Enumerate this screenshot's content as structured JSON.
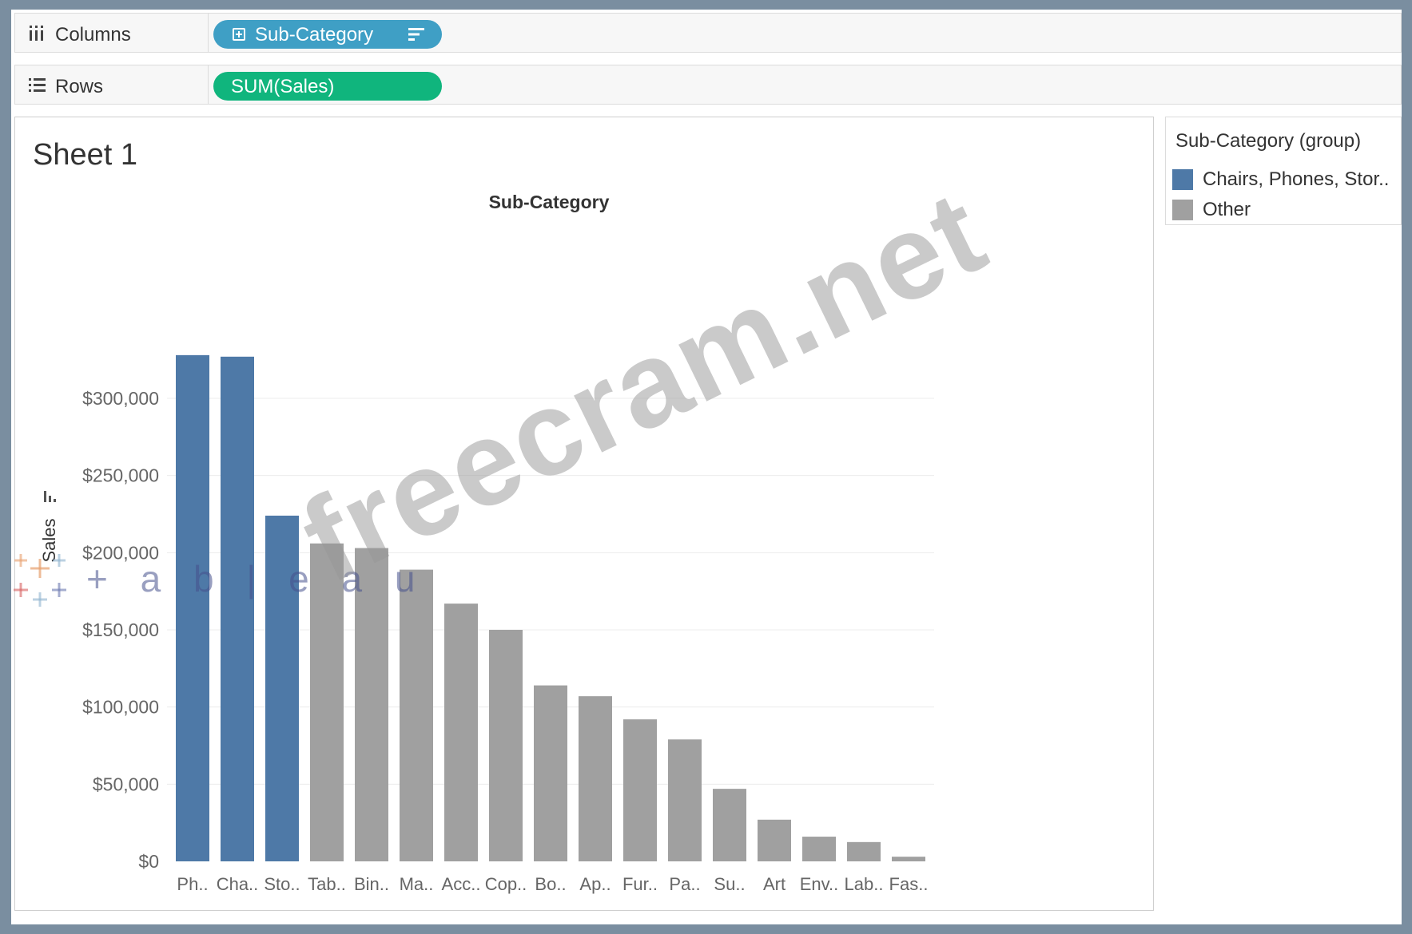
{
  "shelves": {
    "columns": {
      "label": "Columns",
      "pill": "Sub-Category"
    },
    "rows": {
      "label": "Rows",
      "pill": "SUM(Sales)"
    }
  },
  "sheet": {
    "title": "Sheet 1"
  },
  "legend": {
    "title": "Sub-Category (group)",
    "items": [
      {
        "label": "Chairs, Phones, Stor..",
        "color": "#4e79a7"
      },
      {
        "label": "Other",
        "color": "#a0a0a0"
      }
    ]
  },
  "watermark": {
    "text": "freecram.net",
    "logo_text": "+ a b | e a u"
  },
  "chart_data": {
    "type": "bar",
    "title": "Sub-Category",
    "xlabel": "",
    "ylabel": "Sales",
    "ylim": [
      0,
      330000
    ],
    "grid": true,
    "yticks": [
      {
        "value": 0,
        "label": "$0"
      },
      {
        "value": 50000,
        "label": "$50,000"
      },
      {
        "value": 100000,
        "label": "$100,000"
      },
      {
        "value": 150000,
        "label": "$150,000"
      },
      {
        "value": 200000,
        "label": "$200,000"
      },
      {
        "value": 250000,
        "label": "$250,000"
      },
      {
        "value": 300000,
        "label": "$300,000"
      }
    ],
    "categories": [
      "Ph..",
      "Cha..",
      "Sto..",
      "Tab..",
      "Bin..",
      "Ma..",
      "Acc..",
      "Cop..",
      "Bo..",
      "Ap..",
      "Fur..",
      "Pa..",
      "Su..",
      "Art",
      "Env..",
      "Lab..",
      "Fas.."
    ],
    "values": [
      328000,
      327000,
      224000,
      206000,
      203000,
      189000,
      167000,
      150000,
      114000,
      107000,
      92000,
      79000,
      47000,
      27000,
      16000,
      12500,
      3000
    ],
    "groups": [
      "Chairs, Phones, Stor..",
      "Chairs, Phones, Stor..",
      "Chairs, Phones, Stor..",
      "Other",
      "Other",
      "Other",
      "Other",
      "Other",
      "Other",
      "Other",
      "Other",
      "Other",
      "Other",
      "Other",
      "Other",
      "Other",
      "Other"
    ],
    "colors": {
      "Chairs, Phones, Stor..": "#4e79a7",
      "Other": "#a0a0a0"
    }
  }
}
